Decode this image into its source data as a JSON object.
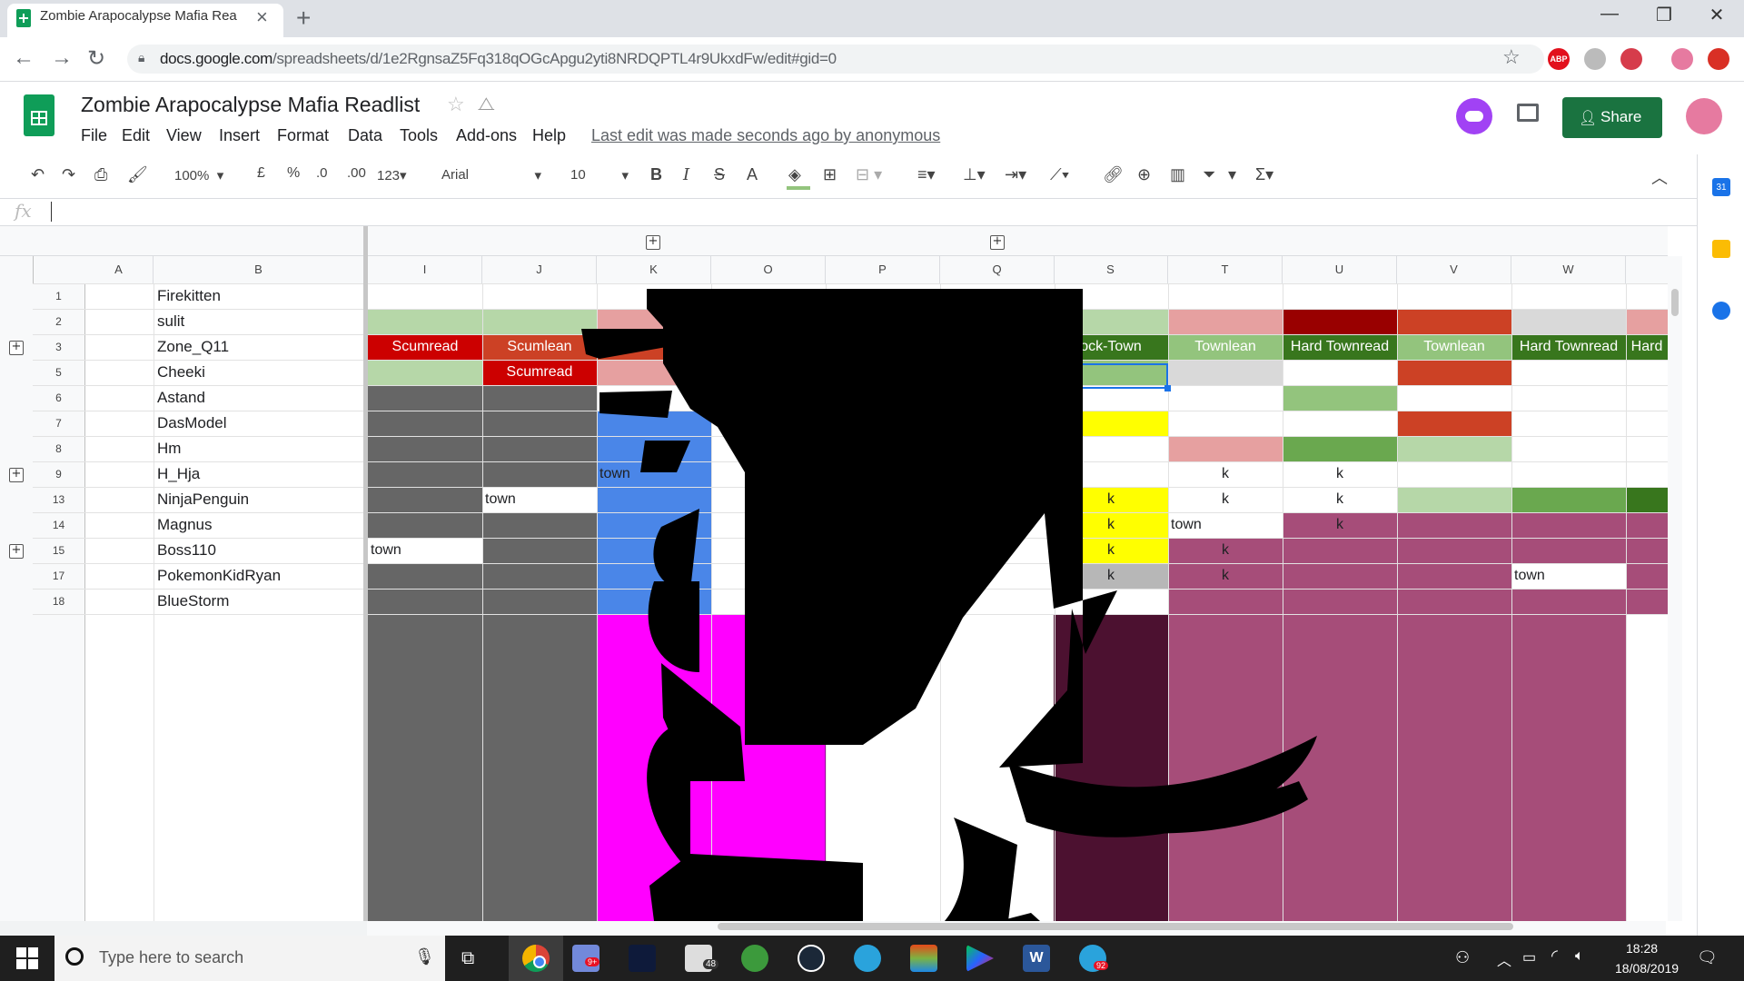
{
  "browser": {
    "tab_title": "Zombie Arapocalypse Mafia Rea",
    "url_domain": "docs.google.com",
    "url_path": "/spreadsheets/d/1e2RgnsaZ5Fq318qOGcApgu2yti8NRDQPTL4r9UkxdFw/edit#gid=0",
    "extensions": [
      {
        "name": "abp",
        "label": "ABP",
        "color": "#e2101c"
      },
      {
        "name": "ext2",
        "label": "",
        "color": "#bbbbbb"
      },
      {
        "name": "pocket",
        "label": "",
        "color": "#d63c4b"
      },
      {
        "name": "profile",
        "label": "",
        "color": "#e67aa0"
      },
      {
        "name": "update",
        "label": "",
        "color": "#d93025"
      }
    ]
  },
  "sheets": {
    "title": "Zombie Arapocalypse Mafia Readlist",
    "menu": [
      "File",
      "Edit",
      "View",
      "Insert",
      "Format",
      "Data",
      "Tools",
      "Add-ons",
      "Help"
    ],
    "last_edit": "Last edit was made seconds ago by anonymous",
    "share_label": "Share"
  },
  "toolbar": {
    "zoom": "100%",
    "currency": "£",
    "percent": "%",
    "dec_less": ".0",
    "dec_more": ".00",
    "format_more": "123",
    "font": "Arial",
    "font_size": "10",
    "bold": "B",
    "italic": "I",
    "strike": "S",
    "text_color": "A",
    "fill_color": "#93c47d"
  },
  "formula": {
    "fx": "fx",
    "value": ""
  },
  "grid": {
    "columns": [
      "A",
      "B",
      "I",
      "J",
      "K",
      "O",
      "P",
      "Q",
      "S",
      "T",
      "U",
      "V",
      "W"
    ],
    "rows": [
      {
        "num": "1",
        "name": "Firekitten"
      },
      {
        "num": "2",
        "name": "sulit"
      },
      {
        "num": "3",
        "name": "Zone_Q11"
      },
      {
        "num": "5",
        "name": "Cheeki"
      },
      {
        "num": "6",
        "name": "Astand"
      },
      {
        "num": "7",
        "name": "DasModel"
      },
      {
        "num": "8",
        "name": "Hm"
      },
      {
        "num": "9",
        "name": "H_Hja"
      },
      {
        "num": "13",
        "name": "NinjaPenguin"
      },
      {
        "num": "14",
        "name": "Magnus"
      },
      {
        "num": "15",
        "name": "Boss110"
      },
      {
        "num": "17",
        "name": "PokemonKidRyan"
      },
      {
        "num": "18",
        "name": "BlueStorm"
      }
    ],
    "cell_text": {
      "I3": "Scumread",
      "J3": "Scumlean",
      "S3": "ock-Town",
      "T3": "Townlean",
      "U3": "Hard Townread",
      "V3": "Townlean",
      "W3": "Hard Townread",
      "X3": "Hard",
      "J5": "Scumread",
      "K9": "town",
      "T9": "k",
      "U9": "k",
      "J13": "town",
      "S13": "k",
      "T13": "k",
      "U13": "k",
      "S14": "k",
      "T14": "town",
      "U14": "k",
      "I15": "town",
      "S15": "k",
      "T15": "k",
      "S17": "k",
      "T17": "k",
      "W17": "town"
    },
    "colors": {
      "light_green": "#b6d7a8",
      "green": "#93c47d",
      "dark_green": "#6aa84f",
      "darker_green": "#38761d",
      "red": "#cc0000",
      "dark_red": "#990000",
      "red_orange": "#cc4125",
      "pink": "#e6a0a0",
      "gray": "#666666",
      "light_gray": "#d9d9d9",
      "mid_gray": "#b7b7b7",
      "yellow": "#ffff00",
      "blue": "#4a86e8",
      "magenta": "#ff00ff",
      "plum": "#a64d79",
      "dark_plum": "#4c1130",
      "black": "#000000"
    }
  },
  "taskbar": {
    "search_placeholder": "Type here to search",
    "time": "18:28",
    "date": "18/08/2019",
    "badges": {
      "games": "9+",
      "mail": "48",
      "telegram": "92"
    }
  }
}
